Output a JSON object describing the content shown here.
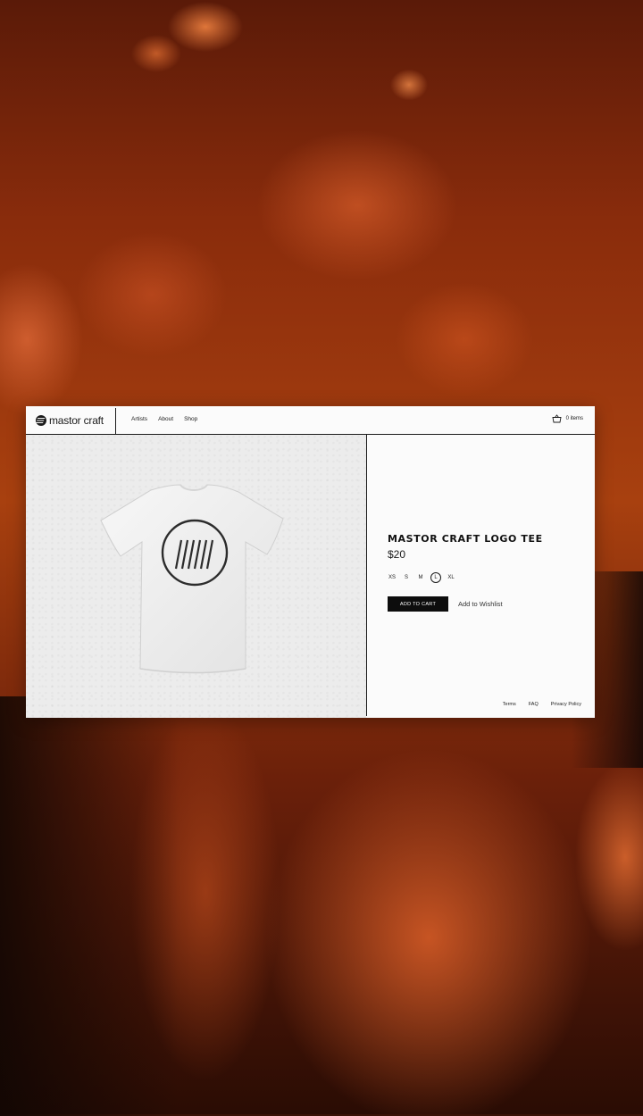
{
  "brand": {
    "name": "mastor craft"
  },
  "nav": {
    "links": [
      "Artists",
      "About",
      "Shop"
    ]
  },
  "cart": {
    "label": "0 items"
  },
  "product": {
    "title": "MASTOR CRAFT LOGO TEE",
    "price": "$20",
    "sizes": [
      "XS",
      "S",
      "M",
      "L",
      "XL"
    ],
    "selected_size": "L",
    "add_to_cart_label": "ADD TO CART",
    "wishlist_label": "Add to Wishlist"
  },
  "footer": {
    "links": [
      "Terms",
      "FAQ",
      "Privacy Policy"
    ]
  },
  "colors": {
    "background_tint": "#b8440f",
    "accent": "#0d0d0d",
    "card": "#fbfbfb"
  }
}
